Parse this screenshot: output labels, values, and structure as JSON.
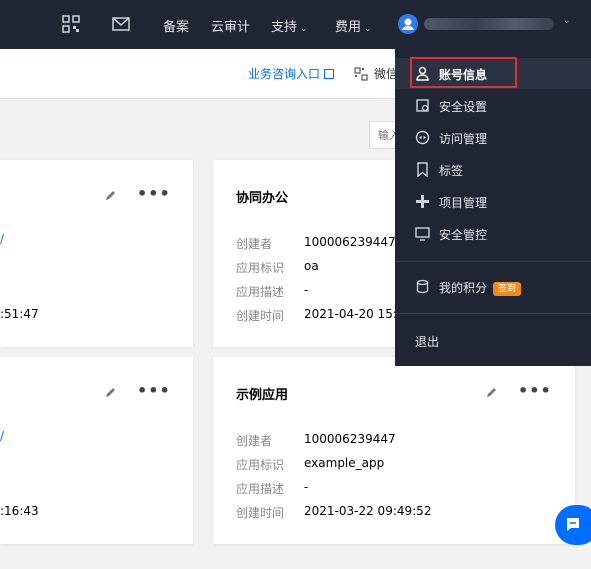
{
  "topnav": {
    "qr_icon": "qrcode-icon",
    "mail_icon": "mail-icon",
    "links": [
      {
        "label": "备案"
      },
      {
        "label": "云审计"
      },
      {
        "label": "支持",
        "caret": "⌄"
      },
      {
        "label": "费用",
        "caret": "⌄"
      }
    ],
    "user_caret": "⌄"
  },
  "subheader": {
    "biz_link": "业务咨询入口",
    "wechat": "微信"
  },
  "search": {
    "placeholder": "输入"
  },
  "left_cards": [
    {
      "fragment_blue": "/",
      "fragment_time": ":51:47"
    },
    {
      "fragment_blue": "/",
      "fragment_time": ":16:43"
    }
  ],
  "cards": [
    {
      "title": "协同办公",
      "rows": [
        {
          "label": "创建者",
          "value": "100006239447"
        },
        {
          "label": "应用标识",
          "value": "oa"
        },
        {
          "label": "应用描述",
          "value": "-"
        },
        {
          "label": "创建时间",
          "value": "2021-04-20 15:35"
        }
      ]
    },
    {
      "title": "示例应用",
      "rows": [
        {
          "label": "创建者",
          "value": "100006239447"
        },
        {
          "label": "应用标识",
          "value": "example_app"
        },
        {
          "label": "应用描述",
          "value": "-"
        },
        {
          "label": "创建时间",
          "value": "2021-03-22 09:49:52"
        }
      ]
    }
  ],
  "more_glyph": "•••",
  "dropdown": {
    "items": [
      {
        "label": "账号信息",
        "icon": "user-icon"
      },
      {
        "label": "安全设置",
        "icon": "security-settings-icon"
      },
      {
        "label": "访问管理",
        "icon": "access-management-icon"
      },
      {
        "label": "标签",
        "icon": "tag-icon"
      },
      {
        "label": "项目管理",
        "icon": "project-icon"
      },
      {
        "label": "安全管控",
        "icon": "security-control-icon"
      }
    ],
    "points": {
      "label": "我的积分",
      "badge": "签到",
      "icon": "points-icon"
    },
    "logout": "退出"
  },
  "colors": {
    "nav_bg": "#1f2532",
    "accent": "#006eff",
    "badge": "#f08c1b",
    "highlight": "#e12f2f"
  }
}
